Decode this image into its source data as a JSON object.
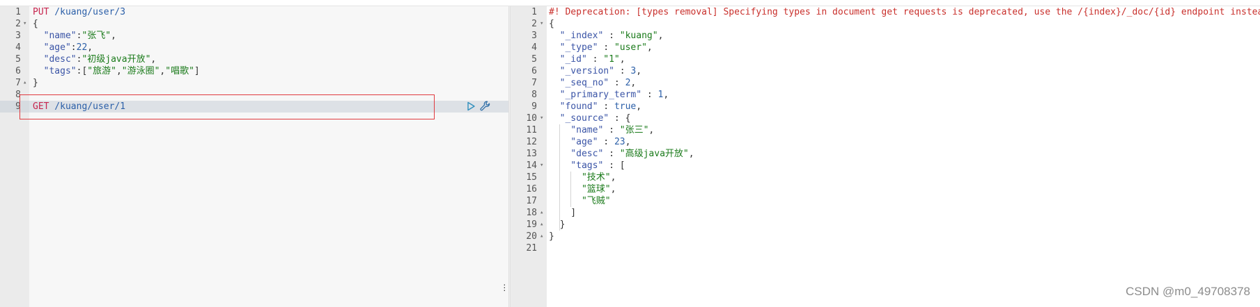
{
  "request_editor": {
    "lines": [
      {
        "num": "1",
        "fold": "",
        "parts": [
          {
            "t": "PUT",
            "c": "k-method"
          },
          {
            "t": " /kuang/user/3",
            "c": "k-url"
          }
        ]
      },
      {
        "num": "2",
        "fold": "▾",
        "parts": [
          {
            "t": "{",
            "c": "k-punc"
          }
        ]
      },
      {
        "num": "3",
        "fold": "",
        "parts": [
          {
            "t": "  \"name\"",
            "c": "k-key"
          },
          {
            "t": ":",
            "c": "k-punc"
          },
          {
            "t": "\"张飞\"",
            "c": "k-str"
          },
          {
            "t": ",",
            "c": "k-punc"
          }
        ]
      },
      {
        "num": "4",
        "fold": "",
        "parts": [
          {
            "t": "  \"age\"",
            "c": "k-key"
          },
          {
            "t": ":",
            "c": "k-punc"
          },
          {
            "t": "22",
            "c": "k-num"
          },
          {
            "t": ",",
            "c": "k-punc"
          }
        ]
      },
      {
        "num": "5",
        "fold": "",
        "parts": [
          {
            "t": "  \"desc\"",
            "c": "k-key"
          },
          {
            "t": ":",
            "c": "k-punc"
          },
          {
            "t": "\"初级java开放\"",
            "c": "k-str"
          },
          {
            "t": ",",
            "c": "k-punc"
          }
        ]
      },
      {
        "num": "6",
        "fold": "",
        "parts": [
          {
            "t": "  \"tags\"",
            "c": "k-key"
          },
          {
            "t": ":[",
            "c": "k-punc"
          },
          {
            "t": "\"旅游\"",
            "c": "k-str"
          },
          {
            "t": ",",
            "c": "k-punc"
          },
          {
            "t": "\"游泳圈\"",
            "c": "k-str"
          },
          {
            "t": ",",
            "c": "k-punc"
          },
          {
            "t": "\"唱歌\"",
            "c": "k-str"
          },
          {
            "t": "]",
            "c": "k-punc"
          }
        ]
      },
      {
        "num": "7",
        "fold": "▴",
        "parts": [
          {
            "t": "}",
            "c": "k-punc"
          }
        ]
      },
      {
        "num": "8",
        "fold": "",
        "parts": []
      },
      {
        "num": "9",
        "fold": "",
        "parts": [
          {
            "t": "GET",
            "c": "k-method"
          },
          {
            "t": " /kuang/user/1",
            "c": "k-url"
          }
        ]
      }
    ]
  },
  "response_viewer": {
    "lines": [
      {
        "num": "1",
        "fold": "",
        "parts": [
          {
            "t": "#! Deprecation: [types removal] Specifying types in document get requests is deprecated, use the /{index}/_doc/{id} endpoint instead.",
            "c": "k-comment"
          }
        ]
      },
      {
        "num": "2",
        "fold": "▾",
        "parts": [
          {
            "t": "{",
            "c": "k-punc"
          }
        ]
      },
      {
        "num": "3",
        "fold": "",
        "parts": [
          {
            "t": "  \"_index\"",
            "c": "k-key"
          },
          {
            "t": " : ",
            "c": "k-punc"
          },
          {
            "t": "\"kuang\"",
            "c": "k-str"
          },
          {
            "t": ",",
            "c": "k-punc"
          }
        ]
      },
      {
        "num": "4",
        "fold": "",
        "parts": [
          {
            "t": "  \"_type\"",
            "c": "k-key"
          },
          {
            "t": " : ",
            "c": "k-punc"
          },
          {
            "t": "\"user\"",
            "c": "k-str"
          },
          {
            "t": ",",
            "c": "k-punc"
          }
        ]
      },
      {
        "num": "5",
        "fold": "",
        "parts": [
          {
            "t": "  \"_id\"",
            "c": "k-key"
          },
          {
            "t": " : ",
            "c": "k-punc"
          },
          {
            "t": "\"1\"",
            "c": "k-str"
          },
          {
            "t": ",",
            "c": "k-punc"
          }
        ]
      },
      {
        "num": "6",
        "fold": "",
        "parts": [
          {
            "t": "  \"_version\"",
            "c": "k-key"
          },
          {
            "t": " : ",
            "c": "k-punc"
          },
          {
            "t": "3",
            "c": "k-num"
          },
          {
            "t": ",",
            "c": "k-punc"
          }
        ]
      },
      {
        "num": "7",
        "fold": "",
        "parts": [
          {
            "t": "  \"_seq_no\"",
            "c": "k-key"
          },
          {
            "t": " : ",
            "c": "k-punc"
          },
          {
            "t": "2",
            "c": "k-num"
          },
          {
            "t": ",",
            "c": "k-punc"
          }
        ]
      },
      {
        "num": "8",
        "fold": "",
        "parts": [
          {
            "t": "  \"_primary_term\"",
            "c": "k-key"
          },
          {
            "t": " : ",
            "c": "k-punc"
          },
          {
            "t": "1",
            "c": "k-num"
          },
          {
            "t": ",",
            "c": "k-punc"
          }
        ]
      },
      {
        "num": "9",
        "fold": "",
        "parts": [
          {
            "t": "  \"found\"",
            "c": "k-key"
          },
          {
            "t": " : ",
            "c": "k-punc"
          },
          {
            "t": "true",
            "c": "k-bool"
          },
          {
            "t": ",",
            "c": "k-punc"
          }
        ]
      },
      {
        "num": "10",
        "fold": "▾",
        "parts": [
          {
            "t": "  \"_source\"",
            "c": "k-key"
          },
          {
            "t": " : {",
            "c": "k-punc"
          }
        ]
      },
      {
        "num": "11",
        "fold": "",
        "parts": [
          {
            "t": "    \"name\"",
            "c": "k-key"
          },
          {
            "t": " : ",
            "c": "k-punc"
          },
          {
            "t": "\"张三\"",
            "c": "k-str"
          },
          {
            "t": ",",
            "c": "k-punc"
          }
        ]
      },
      {
        "num": "12",
        "fold": "",
        "parts": [
          {
            "t": "    \"age\"",
            "c": "k-key"
          },
          {
            "t": " : ",
            "c": "k-punc"
          },
          {
            "t": "23",
            "c": "k-num"
          },
          {
            "t": ",",
            "c": "k-punc"
          }
        ]
      },
      {
        "num": "13",
        "fold": "",
        "parts": [
          {
            "t": "    \"desc\"",
            "c": "k-key"
          },
          {
            "t": " : ",
            "c": "k-punc"
          },
          {
            "t": "\"高级java开放\"",
            "c": "k-str"
          },
          {
            "t": ",",
            "c": "k-punc"
          }
        ]
      },
      {
        "num": "14",
        "fold": "▾",
        "parts": [
          {
            "t": "    \"tags\"",
            "c": "k-key"
          },
          {
            "t": " : [",
            "c": "k-punc"
          }
        ]
      },
      {
        "num": "15",
        "fold": "",
        "parts": [
          {
            "t": "      \"技术\"",
            "c": "k-str"
          },
          {
            "t": ",",
            "c": "k-punc"
          }
        ]
      },
      {
        "num": "16",
        "fold": "",
        "parts": [
          {
            "t": "      \"篮球\"",
            "c": "k-str"
          },
          {
            "t": ",",
            "c": "k-punc"
          }
        ]
      },
      {
        "num": "17",
        "fold": "",
        "parts": [
          {
            "t": "      \"飞贼\"",
            "c": "k-str"
          }
        ]
      },
      {
        "num": "18",
        "fold": "▴",
        "parts": [
          {
            "t": "    ]",
            "c": "k-punc"
          }
        ]
      },
      {
        "num": "19",
        "fold": "▴",
        "parts": [
          {
            "t": "  }",
            "c": "k-punc"
          }
        ]
      },
      {
        "num": "20",
        "fold": "▴",
        "parts": [
          {
            "t": "}",
            "c": "k-punc"
          }
        ]
      },
      {
        "num": "21",
        "fold": "",
        "parts": []
      }
    ]
  },
  "toolbar": {
    "run_icon": "play-icon",
    "settings_icon": "wrench-icon",
    "menu_icon": "kebab-menu-icon"
  },
  "watermark": "CSDN @m0_49708378",
  "colors": {
    "highlight_box": "#e0393e",
    "method": "#c7254e",
    "string": "#1a7a1a",
    "key": "#3a54a6",
    "comment": "#c9302c"
  }
}
